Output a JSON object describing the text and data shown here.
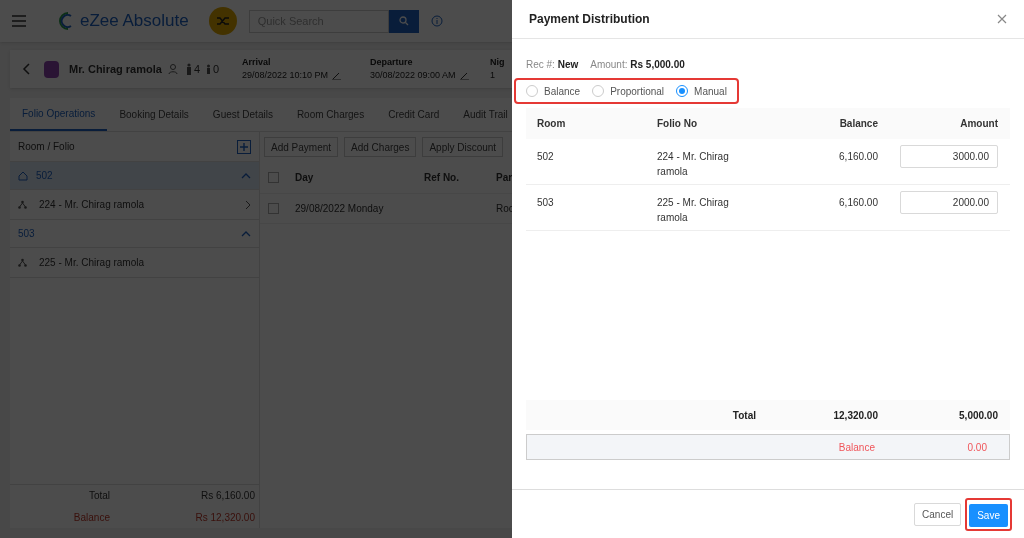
{
  "header": {
    "app_name": "eZee Absolute",
    "search_placeholder": "Quick Search"
  },
  "guest": {
    "name": "Mr. Chirag ramola",
    "adults": "4",
    "children": "0",
    "arrival_label": "Arrival",
    "arrival": "29/08/2022 10:10 PM",
    "departure_label": "Departure",
    "departure": "30/08/2022 09:00 AM",
    "nights_label": "Nig",
    "nights": "1"
  },
  "tabs": [
    {
      "label": "Folio Operations",
      "selected": true
    },
    {
      "label": "Booking Details",
      "selected": false
    },
    {
      "label": "Guest Details",
      "selected": false
    },
    {
      "label": "Room Charges",
      "selected": false
    },
    {
      "label": "Credit Card",
      "selected": false
    },
    {
      "label": "Audit Trail",
      "selected": false
    }
  ],
  "folio_panel": {
    "title": "Room / Folio",
    "rooms": [
      {
        "room": "502",
        "selected": true,
        "expanded": true,
        "children": [
          {
            "label": "224 - Mr. Chirag ramola"
          }
        ]
      },
      {
        "room": "503",
        "selected": false,
        "expanded": true,
        "children": [
          {
            "label": "225 - Mr. Chirag ramola"
          }
        ]
      }
    ],
    "total_label": "Total",
    "total": "Rs 6,160.00",
    "balance_label": "Balance",
    "balance": "Rs 12,320.00"
  },
  "actions": [
    "Add Payment",
    "Add Charges",
    "Apply Discount"
  ],
  "grid": {
    "header_checked": false,
    "columns": [
      "Day",
      "Ref No.",
      "Par"
    ],
    "rows": [
      {
        "checked": false,
        "day": "29/08/2022 Monday",
        "ref": "",
        "column_3": "Roo"
      }
    ]
  },
  "dialog": {
    "title": "Payment Distribution",
    "rec_label": "Rec #:",
    "rec": "New",
    "amount_label": "Amount:",
    "amount": "Rs 5,000.00",
    "modes_highlighted": true,
    "modes": [
      {
        "label": "Balance",
        "selected": false
      },
      {
        "label": "Proportional",
        "selected": false
      },
      {
        "label": "Manual",
        "selected": true
      }
    ],
    "columns": [
      "Room",
      "Folio No",
      "Balance",
      "Amount"
    ],
    "rows": [
      {
        "room": "502",
        "folio": "224 - Mr. Chirag ramola",
        "balance": "6,160.00",
        "amount": "3000.00"
      },
      {
        "room": "503",
        "folio": "225 - Mr. Chirag ramola",
        "balance": "6,160.00",
        "amount": "2000.00"
      }
    ],
    "total_label": "Total",
    "total_balance": "12,320.00",
    "total_amount": "5,000.00",
    "balance_label": "Balance",
    "balance_amount": "0.00",
    "cancel": "Cancel",
    "save": "Save",
    "save_highlighted": true
  }
}
